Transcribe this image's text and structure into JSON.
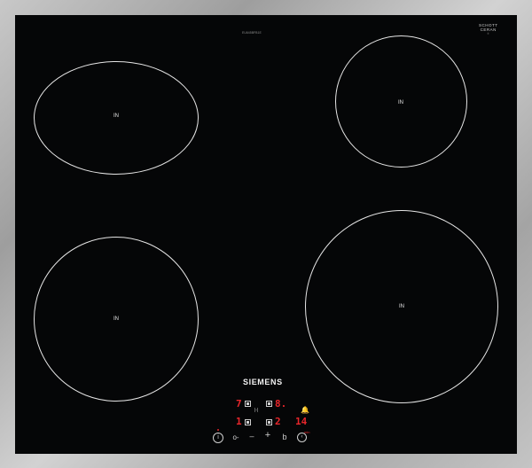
{
  "cooktop": {
    "zones": [
      {
        "label": "IN"
      },
      {
        "label": "IN"
      },
      {
        "label": "IN"
      },
      {
        "label": "IN"
      }
    ],
    "model_code": "EU645BFB1E",
    "badge": {
      "line1": "SCHOTT",
      "line2": "CERAN",
      "line3": "®"
    },
    "brand": "SIEMENS",
    "displays": {
      "front_left": "7",
      "rear_left": "8.",
      "front_center": "1",
      "rear_right": "2",
      "timer": "14"
    },
    "timer_unit": "min",
    "controls": {
      "power_icon": "power-icon",
      "lock_icon": "child-lock-icon",
      "minus_icon": "minus-icon",
      "plus_icon": "plus-icon",
      "boost_icon": "boost-icon",
      "timer_icon": "clock-icon",
      "bell_icon": "bell-icon"
    },
    "colors": {
      "glass": "#050607",
      "frame": "#b5b5b5",
      "display": "#e8262b",
      "zone_outline": "#e6e6e6"
    }
  }
}
